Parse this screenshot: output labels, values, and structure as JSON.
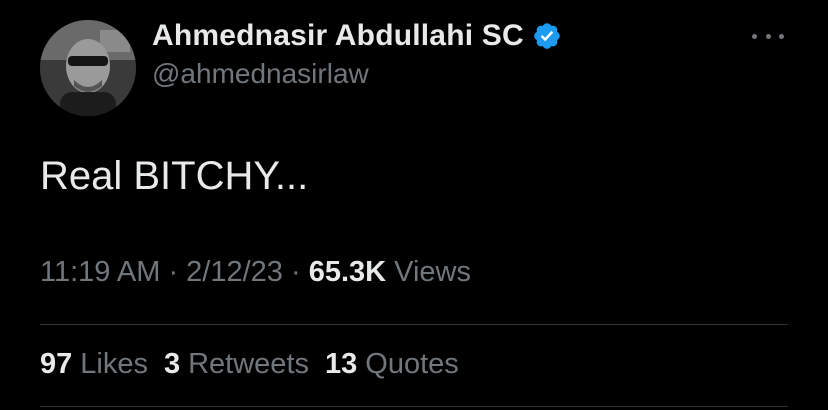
{
  "user": {
    "display_name": "Ahmednasir Abdullahi SC",
    "handle": "@ahmednasirlaw",
    "verified": true
  },
  "tweet": {
    "text": "Real BITCHY..."
  },
  "meta": {
    "time": "11:19 AM",
    "separator1": " · ",
    "date": "2/12/23",
    "separator2": " · ",
    "views_count": "65.3K",
    "views_label": " Views"
  },
  "stats": {
    "likes_count": "97",
    "likes_label": "Likes",
    "retweets_count": "3",
    "retweets_label": "Retweets",
    "quotes_count": "13",
    "quotes_label": "Quotes"
  },
  "icons": {
    "verified": "verified-badge-icon",
    "more": "more-horizontal-icon"
  },
  "colors": {
    "background": "#000000",
    "primary_text": "#e7e9ea",
    "secondary_text": "#71767b",
    "verified_blue": "#1d9bf0",
    "divider": "#2f3336"
  }
}
